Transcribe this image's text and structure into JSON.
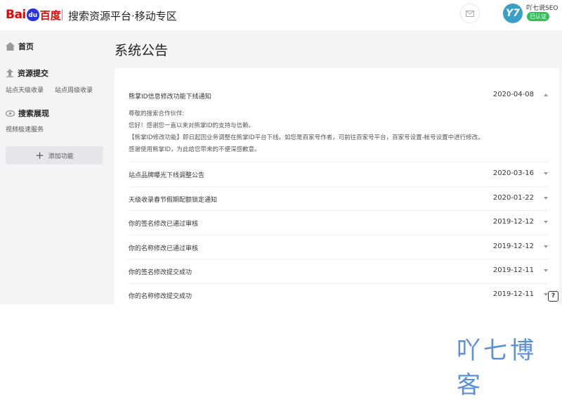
{
  "header": {
    "logo_text_bai": "Bai",
    "logo_paw": "du",
    "logo_text_baidu": "百度",
    "site_title": "搜索资源平台·移动专区",
    "username": "吖七说SEO",
    "verified_badge": "已认证",
    "avatar_text": "Y7",
    "mail_icon": "mail-icon"
  },
  "sidebar": {
    "home": "首页",
    "groups": [
      {
        "label": "资源提交",
        "icon": "upload-icon",
        "items": [
          "站点天级收录",
          "站点周级收录"
        ]
      },
      {
        "label": "搜索展现",
        "icon": "eye-icon",
        "items": [
          "视频极速服务"
        ]
      }
    ],
    "add_button": "添加功能"
  },
  "main": {
    "page_title": "系统公告",
    "notices": [
      {
        "title": "熊掌ID信息修改功能下线通知",
        "date": "2020-04-08",
        "expanded": true,
        "body": [
          "尊敬的搜索合作伙伴:",
          "您好！感谢您一直以来对熊掌ID的支持与信赖。",
          "【熊掌ID修改功能】即日起因业务调整在熊掌ID平台下线。如您是百家号作者，可前往百家号平台，百家号设置-帐号设置中进行修改。",
          "感谢使用熊掌ID，为此给您带来的不便深感歉意。"
        ]
      },
      {
        "title": "站点品牌曝光下线调整公告",
        "date": "2020-03-16",
        "expanded": false
      },
      {
        "title": "天级收录春节假期配额锁定通知",
        "date": "2020-01-22",
        "expanded": false
      },
      {
        "title": "你的签名修改已通过审核",
        "date": "2019-12-12",
        "expanded": false
      },
      {
        "title": "你的名称修改已通过审核",
        "date": "2019-12-12",
        "expanded": false
      },
      {
        "title": "你的签名修改提交成功",
        "date": "2019-12-11",
        "expanded": false
      },
      {
        "title": "你的名称修改提交成功",
        "date": "2019-12-11",
        "expanded": false
      }
    ]
  },
  "help_button": "?",
  "watermark": "吖七博客",
  "colors": {
    "brand_red": "#e10601",
    "brand_blue": "#2932e1",
    "verified_green": "#2fbf5b",
    "avatar_blue": "#3a9fc8",
    "watermark_blue": "#5b8fdc"
  }
}
